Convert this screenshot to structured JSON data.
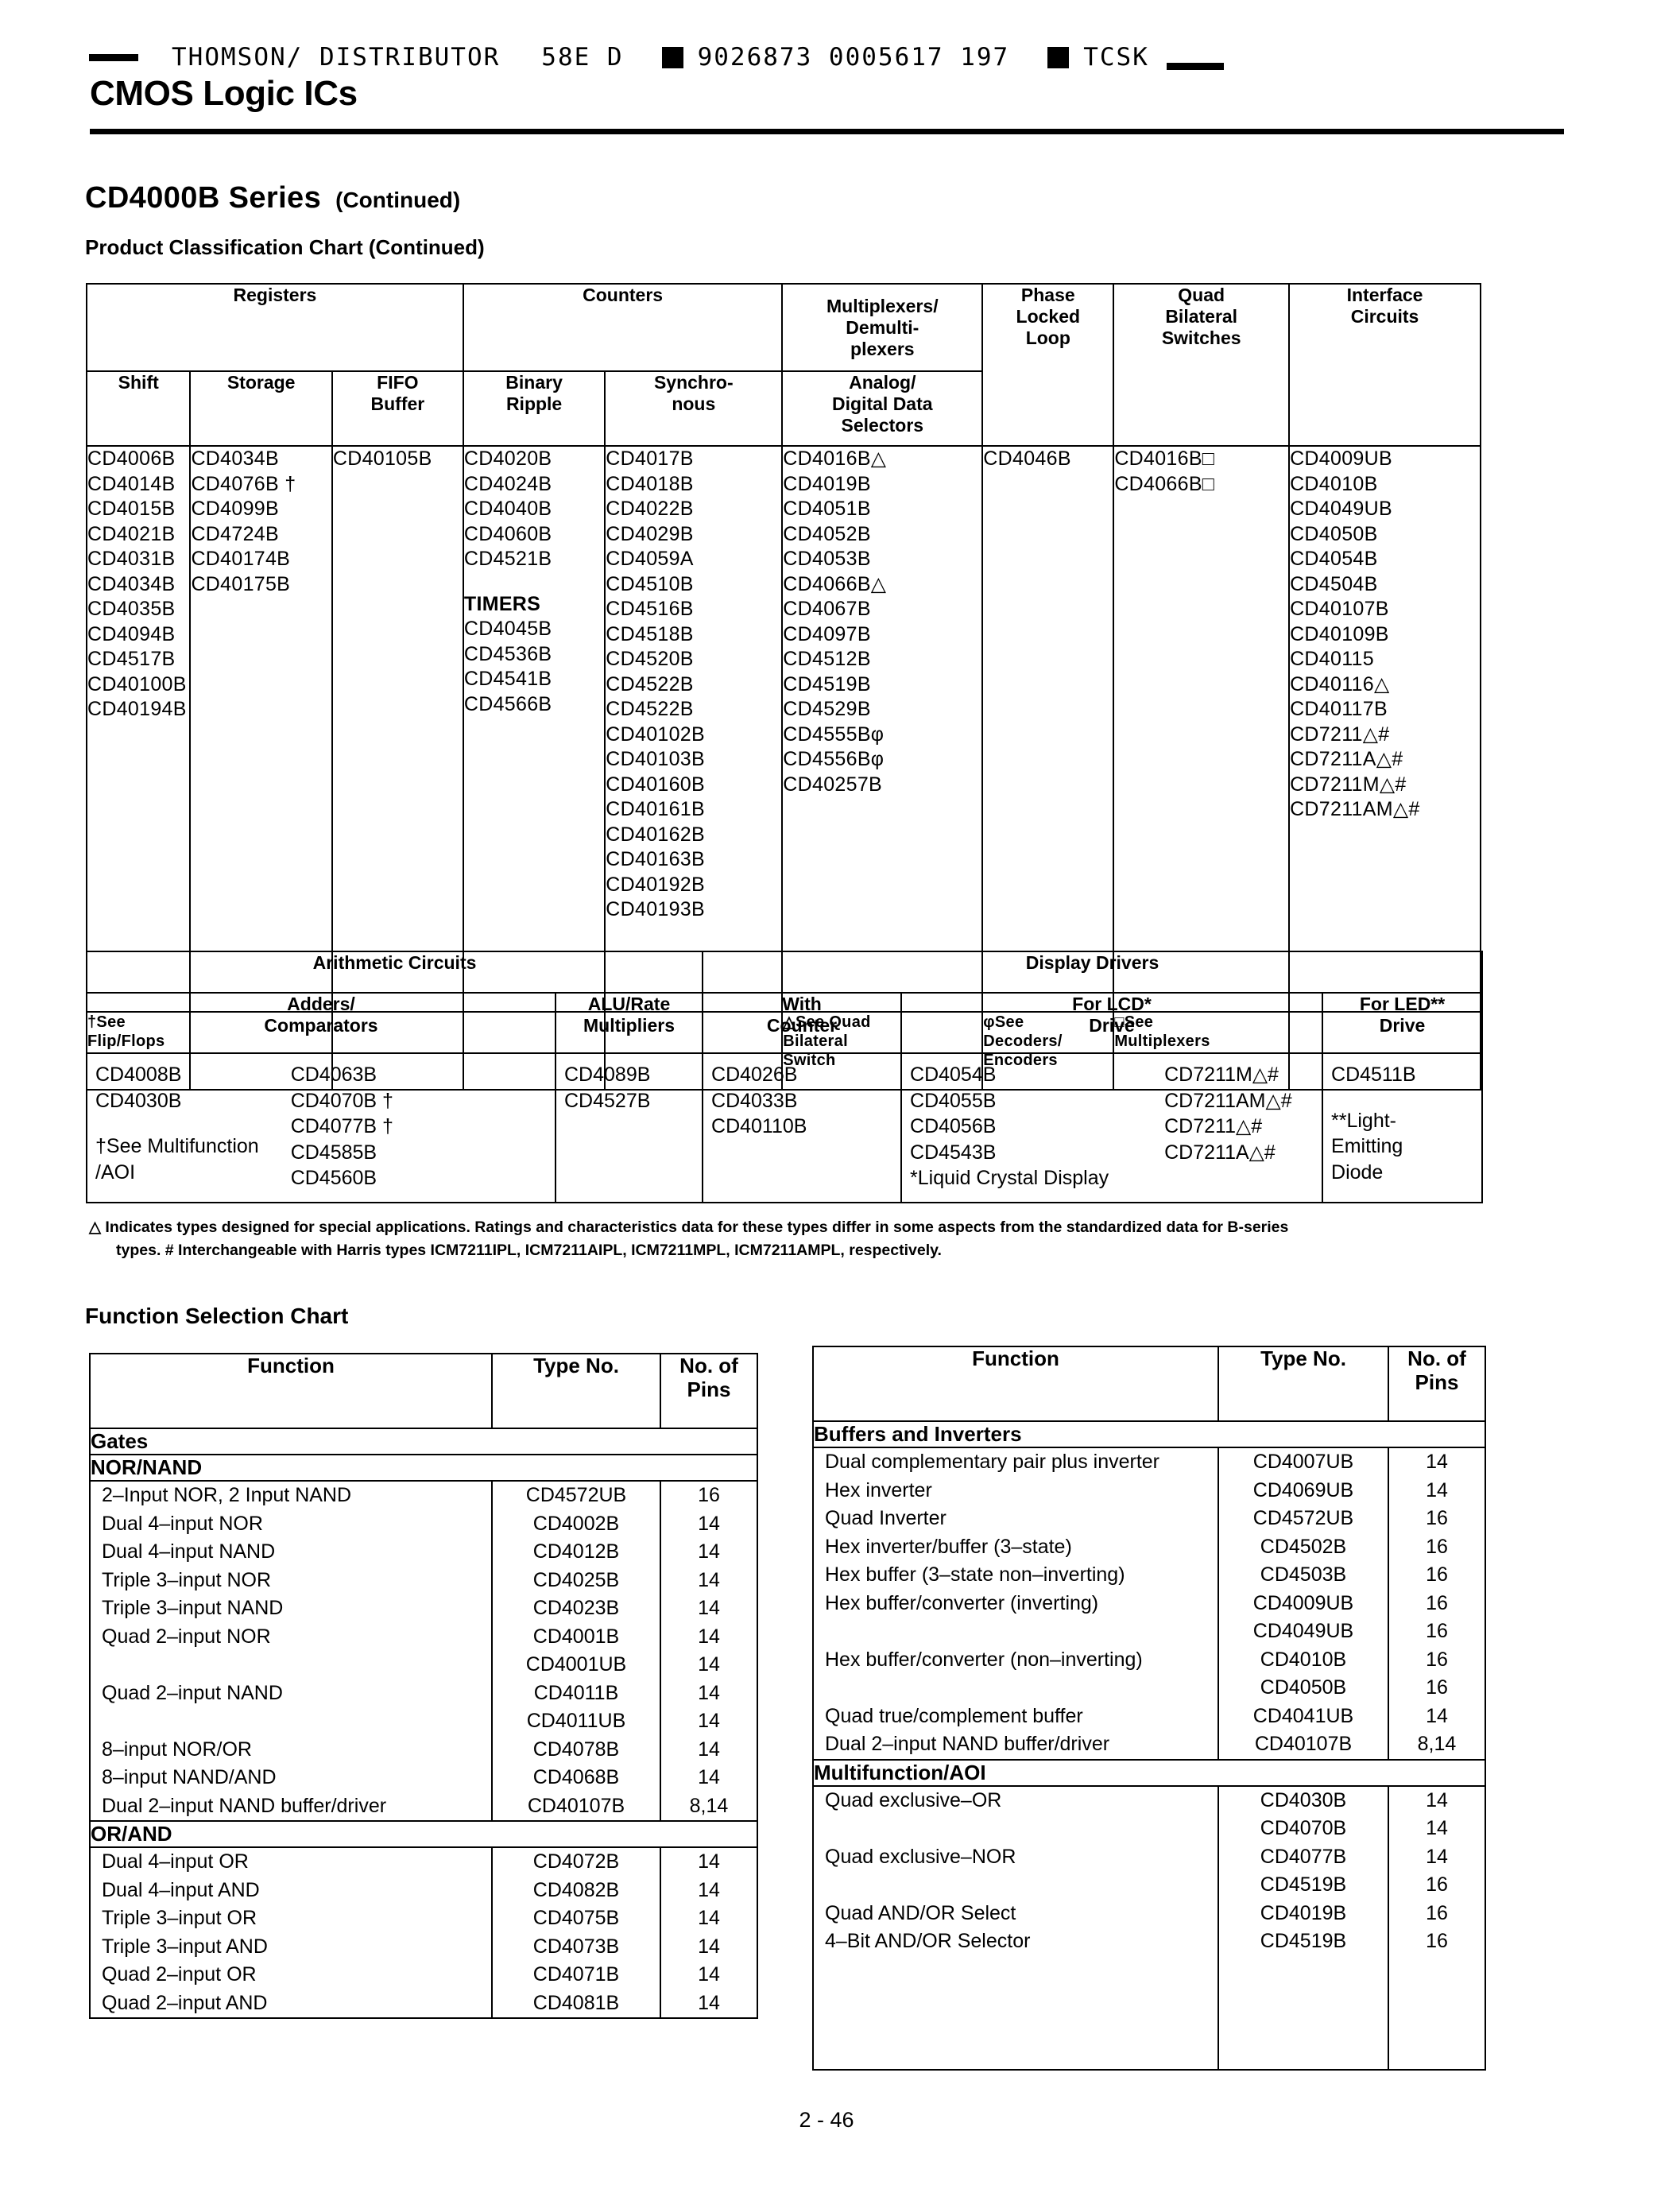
{
  "scan_header": {
    "distributor": "THOMSON/ DISTRIBUTOR",
    "code": "58E D",
    "barcode_numbers": "9026873 0005617 197",
    "suffix": "TCSK"
  },
  "masthead": {
    "title": "CMOS Logic ICs"
  },
  "page_title": {
    "series": "CD4000B Series",
    "continued": "(Continued)",
    "subtitle": "Product Classification Chart (Continued)"
  },
  "classification_table": {
    "group_headers": {
      "registers": "Registers",
      "counters": "Counters",
      "multiplexers": "Multiplexers/\nDemulti-\nplexers"
    },
    "columns": [
      {
        "header": "Shift",
        "items": [
          "CD4006B",
          "CD4014B",
          "CD4015B",
          "CD4021B",
          "CD4031B",
          "CD4034B",
          "CD4035B",
          "CD4094B",
          "CD4517B",
          "CD40100B",
          "CD40194B"
        ],
        "note": "†See\nFlip/Flops"
      },
      {
        "header": "Storage",
        "items": [
          "CD4034B",
          "CD4076B †",
          "CD4099B",
          "CD4724B",
          "CD40174B",
          "CD40175B"
        ],
        "note": ""
      },
      {
        "header": "FIFO\nBuffer",
        "items": [
          "CD40105B"
        ],
        "note": ""
      },
      {
        "header": "Binary\nRipple",
        "items": [
          "CD4020B",
          "CD4024B",
          "CD4040B",
          "CD4060B",
          "CD4521B",
          "",
          "TIMERS",
          "CD4045B",
          "CD4536B",
          "CD4541B",
          "CD4566B"
        ],
        "bold_items": [
          "TIMERS"
        ],
        "note": ""
      },
      {
        "header": "Synchro-\nnous",
        "items": [
          "CD4017B",
          "CD4018B",
          "CD4022B",
          "CD4029B",
          "CD4059A",
          "CD4510B",
          "CD4516B",
          "CD4518B",
          "CD4520B",
          "CD4522B",
          "CD4522B",
          "CD40102B",
          "CD40103B",
          "CD40160B",
          "CD40161B",
          "CD40162B",
          "CD40163B",
          "CD40192B",
          "CD40193B"
        ],
        "note": ""
      },
      {
        "header": "Analog/\nDigital Data\nSelectors",
        "items": [
          "CD4016B△",
          "CD4019B",
          "CD4051B",
          "CD4052B",
          "CD4053B",
          "CD4066B△",
          "CD4067B",
          "CD4097B",
          "CD4512B",
          "CD4519B",
          "CD4529B",
          "CD4555Bφ",
          "CD4556Bφ",
          "CD40257B"
        ],
        "note": "△See Quad\nBilateral\nSwitch"
      },
      {
        "header": "Phase\nLocked\nLoop",
        "items": [
          "CD4046B"
        ],
        "note": "φSee\nDecoders/\nEncoders"
      },
      {
        "header": "Quad\nBilateral\nSwitches",
        "items": [
          "CD4016B□",
          "CD4066B□"
        ],
        "note": "□See\nMultiplexers"
      },
      {
        "header": "Interface\nCircuits",
        "items": [
          "CD4009UB",
          "CD4010B",
          "CD4049UB",
          "CD4050B",
          "CD4054B",
          "CD4504B",
          "CD40107B",
          "CD40109B",
          "CD40115",
          "CD40116△",
          "CD40117B",
          "CD7211△#",
          "CD7211A△#",
          "CD7211M△#",
          "CD7211AM△#"
        ],
        "note": ""
      }
    ]
  },
  "arithmetic_display_table": {
    "group_headers": {
      "arithmetic": "Arithmetic Circuits",
      "display": "Display Drivers"
    },
    "columns": [
      {
        "header": "Adders/\nComparators",
        "col_a": [
          "CD4008B",
          "CD4030B",
          "",
          "†See Multifunction",
          "/AOI"
        ],
        "col_b": [
          "CD4063B",
          "CD4070B †",
          "CD4077B †",
          "CD4585B",
          "CD4560B"
        ]
      },
      {
        "header": "ALU/Rate\nMultipliers",
        "col_a": [
          "CD4089B",
          "CD4527B"
        ],
        "col_b": []
      },
      {
        "header": "With\nCounter",
        "col_a": [
          "CD4026B",
          "CD4033B",
          "CD40110B"
        ],
        "col_b": []
      },
      {
        "header": "For LCD*\nDrive",
        "col_a": [
          "CD4054B",
          "CD4055B",
          "CD4056B",
          "CD4543B",
          "*Liquid Crystal Display"
        ],
        "col_b": [
          "CD7211M△#",
          "CD7211AM△#",
          "CD7211△#",
          "CD7211A△#"
        ]
      },
      {
        "header": "For LED**\nDrive",
        "col_a": [
          "CD4511B",
          "",
          "**Light-",
          "Emitting",
          "Diode"
        ],
        "col_b": []
      }
    ]
  },
  "footnote": {
    "line1": "△ Indicates types designed for special applications. Ratings and characteristics data for these types differ in some aspects from the standardized data for B-series",
    "line2": "types. # Interchangeable with Harris types ICM7211IPL, ICM7211AIPL, ICM7211MPL, ICM7211AMPL, respectively."
  },
  "function_selection": {
    "title": "Function Selection Chart",
    "headers": {
      "function": "Function",
      "type": "Type No.",
      "pins": "No. of\nPins"
    },
    "left_table": {
      "sections": [
        {
          "group": "Gates",
          "rows": []
        },
        {
          "group": "NOR/NAND",
          "rows": [
            {
              "function": "2–Input NOR, 2 Input NAND",
              "type": "CD4572UB",
              "pins": "16"
            },
            {
              "function": "Dual 4–input NOR",
              "type": "CD4002B",
              "pins": "14"
            },
            {
              "function": "Dual 4–input NAND",
              "type": "CD4012B",
              "pins": "14"
            },
            {
              "function": "Triple 3–input NOR",
              "type": "CD4025B",
              "pins": "14"
            },
            {
              "function": "Triple 3–input NAND",
              "type": "CD4023B",
              "pins": "14"
            },
            {
              "function": "Quad 2–input NOR",
              "type": "CD4001B",
              "pins": "14"
            },
            {
              "function": "",
              "type": "CD4001UB",
              "pins": "14"
            },
            {
              "function": "Quad 2–input NAND",
              "type": "CD4011B",
              "pins": "14"
            },
            {
              "function": "",
              "type": "CD4011UB",
              "pins": "14"
            },
            {
              "function": "8–input NOR/OR",
              "type": "CD4078B",
              "pins": "14"
            },
            {
              "function": "8–input NAND/AND",
              "type": "CD4068B",
              "pins": "14"
            },
            {
              "function": "Dual 2–input NAND buffer/driver",
              "type": "CD40107B",
              "pins": "8,14"
            }
          ]
        },
        {
          "group": "OR/AND",
          "rows": [
            {
              "function": "Dual 4–input OR",
              "type": "CD4072B",
              "pins": "14"
            },
            {
              "function": "Dual 4–input AND",
              "type": "CD4082B",
              "pins": "14"
            },
            {
              "function": "Triple 3–input OR",
              "type": "CD4075B",
              "pins": "14"
            },
            {
              "function": "Triple 3–input AND",
              "type": "CD4073B",
              "pins": "14"
            },
            {
              "function": "Quad 2–input OR",
              "type": "CD4071B",
              "pins": "14"
            },
            {
              "function": "Quad 2–input AND",
              "type": "CD4081B",
              "pins": "14"
            }
          ]
        }
      ]
    },
    "right_table": {
      "sections": [
        {
          "group": "Buffers and Inverters",
          "rows": [
            {
              "function": "Dual complementary pair plus inverter",
              "type": "CD4007UB",
              "pins": "14"
            },
            {
              "function": "Hex inverter",
              "type": "CD4069UB",
              "pins": "14"
            },
            {
              "function": "Quad Inverter",
              "type": "CD4572UB",
              "pins": "16"
            },
            {
              "function": "Hex inverter/buffer (3–state)",
              "type": "CD4502B",
              "pins": "16"
            },
            {
              "function": "Hex buffer (3–state non–inverting)",
              "type": "CD4503B",
              "pins": "16"
            },
            {
              "function": "Hex buffer/converter (inverting)",
              "type": "CD4009UB",
              "pins": "16"
            },
            {
              "function": "",
              "type": "CD4049UB",
              "pins": "16"
            },
            {
              "function": "Hex buffer/converter (non–inverting)",
              "type": "CD4010B",
              "pins": "16"
            },
            {
              "function": "",
              "type": "CD4050B",
              "pins": "16"
            },
            {
              "function": "Quad true/complement buffer",
              "type": "CD4041UB",
              "pins": "14"
            },
            {
              "function": "Dual 2–input NAND buffer/driver",
              "type": "CD40107B",
              "pins": "8,14"
            }
          ]
        },
        {
          "group": "Multifunction/AOI",
          "rows": [
            {
              "function": "Quad exclusive–OR",
              "type": "CD4030B",
              "pins": "14"
            },
            {
              "function": "",
              "type": "CD4070B",
              "pins": "14"
            },
            {
              "function": "Quad exclusive–NOR",
              "type": "CD4077B",
              "pins": "14"
            },
            {
              "function": "",
              "type": "CD4519B",
              "pins": "16"
            },
            {
              "function": "Quad AND/OR Select",
              "type": "CD4019B",
              "pins": "16"
            },
            {
              "function": "4–Bit AND/OR Selector",
              "type": "CD4519B",
              "pins": "16"
            }
          ]
        }
      ]
    }
  },
  "page_number": "2 - 46"
}
